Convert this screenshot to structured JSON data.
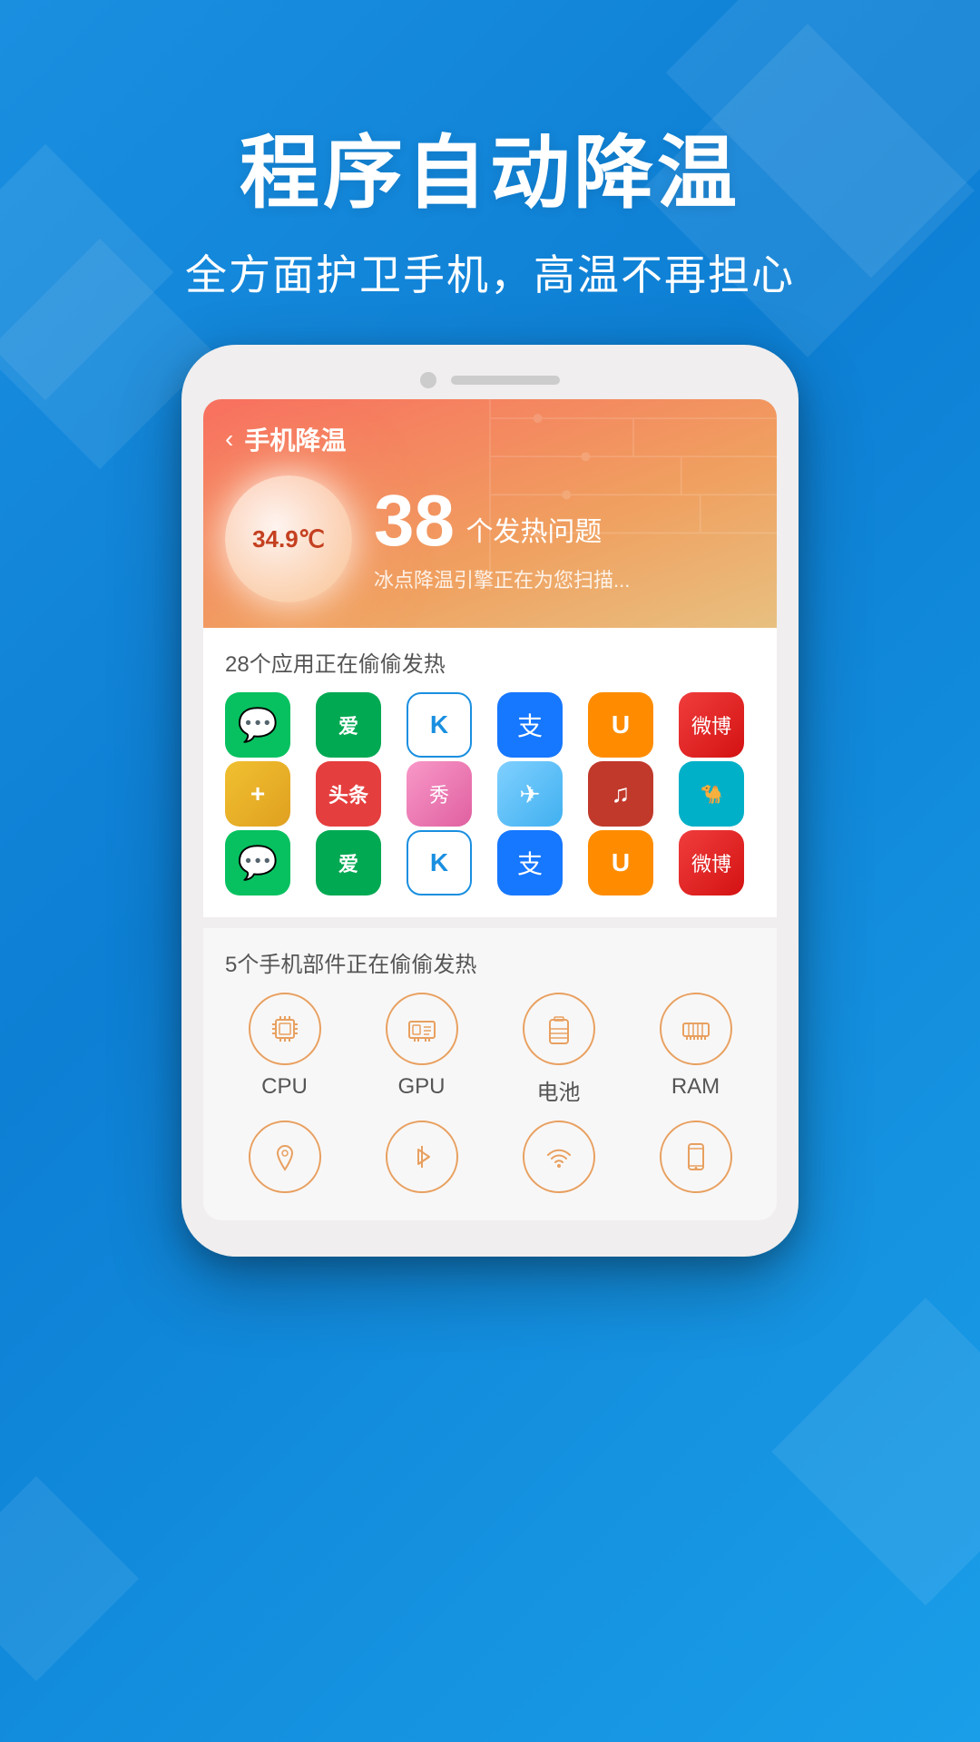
{
  "background": {
    "color": "#1a8fe0"
  },
  "header": {
    "title": "程序自动降温",
    "subtitle": "全方面护卫手机，高温不再担心"
  },
  "app": {
    "nav": {
      "back_icon": "‹",
      "title": "手机降温"
    },
    "temp": {
      "value": "34.9℃"
    },
    "issues": {
      "count": "38",
      "label": "个发热问题",
      "desc": "冰点降温引擎正在为您扫描..."
    },
    "apps_section": {
      "title": "28个应用正在偷偷发热",
      "row1": [
        {
          "name": "WeChat",
          "icon": "💬",
          "class": "icon-wechat"
        },
        {
          "name": "iQIYI",
          "icon": "▶",
          "class": "icon-iqiyi"
        },
        {
          "name": "Kuwo",
          "icon": "K",
          "class": "icon-kuwo"
        },
        {
          "name": "Alipay",
          "icon": "支",
          "class": "icon-alipay"
        },
        {
          "name": "UC",
          "icon": "U",
          "class": "icon-uc"
        },
        {
          "name": "Weibo",
          "icon": "微",
          "class": "icon-weibo"
        }
      ],
      "row2": [
        {
          "name": "Health",
          "icon": "+",
          "class": "icon-health"
        },
        {
          "name": "Toutiao",
          "icon": "头",
          "class": "icon-toutiao"
        },
        {
          "name": "Meixiu",
          "icon": "秀",
          "class": "icon-meixiu"
        },
        {
          "name": "Maps",
          "icon": "✈",
          "class": "icon-maps"
        },
        {
          "name": "NetEase",
          "icon": "♫",
          "class": "icon-netease"
        },
        {
          "name": "Sogou",
          "icon": "🐪",
          "class": "icon-sogou"
        }
      ],
      "row3": [
        {
          "name": "WeChat2",
          "icon": "💬",
          "class": "icon-wechat"
        },
        {
          "name": "iQIYI2",
          "icon": "▶",
          "class": "icon-iqiyi"
        },
        {
          "name": "Kuwo2",
          "icon": "K",
          "class": "icon-kuwo"
        },
        {
          "name": "Alipay2",
          "icon": "支",
          "class": "icon-alipay"
        },
        {
          "name": "UC2",
          "icon": "U",
          "class": "icon-uc"
        },
        {
          "name": "Weibo2",
          "icon": "微",
          "class": "icon-weibo"
        }
      ]
    },
    "components_section": {
      "title": "5个手机部件正在偷偷发热",
      "row1": [
        {
          "name": "CPU",
          "label": "CPU",
          "icon": "⬛"
        },
        {
          "name": "GPU",
          "label": "GPU",
          "icon": "📋"
        },
        {
          "name": "Battery",
          "label": "电池",
          "icon": "🔋"
        },
        {
          "name": "RAM",
          "label": "RAM",
          "icon": "▦"
        }
      ],
      "row2": [
        {
          "name": "Location",
          "label": "",
          "icon": "📍"
        },
        {
          "name": "Bluetooth",
          "label": "",
          "icon": "⚡"
        },
        {
          "name": "WiFi",
          "label": "",
          "icon": "📶"
        },
        {
          "name": "Screen",
          "label": "",
          "icon": "📱"
        }
      ]
    }
  }
}
